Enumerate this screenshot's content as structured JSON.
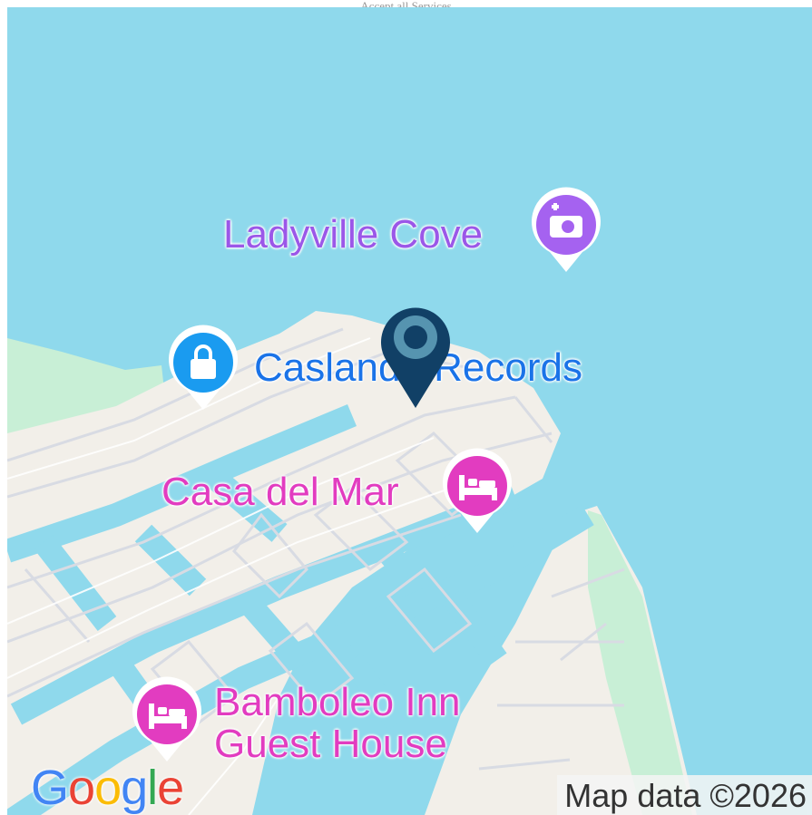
{
  "top_caption": "Accept all Services",
  "map": {
    "colors": {
      "water": "#8fd9ec",
      "land": "#f2efe9",
      "park": "#c8efd6",
      "road": "#ffffff",
      "marker": "#114066"
    },
    "pois": [
      {
        "label": "Ladyville Cove",
        "icon": "camera-icon",
        "color": "#a562f0"
      },
      {
        "label": "Caslando Records",
        "icon": "shopping-bag-icon",
        "color": "#1a9bf0"
      },
      {
        "label": "Casa del Mar",
        "icon": "bed-icon",
        "color": "#e23cc0"
      },
      {
        "label_line1": "Bamboleo Inn",
        "label_line2": "Guest House",
        "icon": "bed-icon",
        "color": "#e23cc0"
      }
    ],
    "marker_icon": "location-pin-icon"
  },
  "google_logo": {
    "letters": [
      "G",
      "o",
      "o",
      "g",
      "l",
      "e"
    ],
    "colors": [
      "#4285f4",
      "#ea4335",
      "#fbbc05",
      "#4285f4",
      "#34a853",
      "#ea4335"
    ]
  },
  "attribution": "Map data ©2026"
}
